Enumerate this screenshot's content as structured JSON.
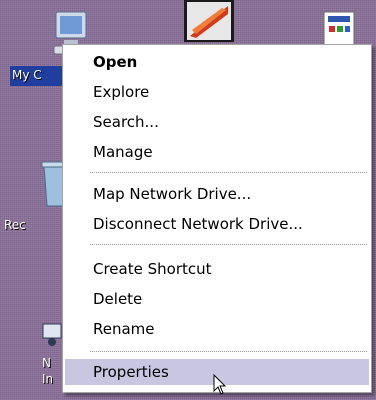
{
  "desktop": {
    "icons": [
      {
        "name": "my-computer-icon",
        "label": "My C"
      },
      {
        "name": "recycle-bin-icon",
        "label": "Rec"
      },
      {
        "name": "network-icon",
        "label_line1": "N",
        "label_line2": "In"
      }
    ]
  },
  "menu": {
    "items": [
      {
        "label": "Open",
        "bold": true
      },
      {
        "label": "Explore"
      },
      {
        "label": "Search..."
      },
      {
        "label": "Manage"
      },
      {
        "label": "Map Network Drive..."
      },
      {
        "label": "Disconnect Network Drive..."
      },
      {
        "label": "Create Shortcut"
      },
      {
        "label": "Delete"
      },
      {
        "label": "Rename"
      },
      {
        "label": "Properties",
        "selected": true
      }
    ]
  },
  "colors": {
    "desktop_bg": "#8a6f9a",
    "menu_bg": "#ffffff",
    "highlight": "#c9c6e2",
    "label_selected_bg": "#1f3e9e"
  }
}
